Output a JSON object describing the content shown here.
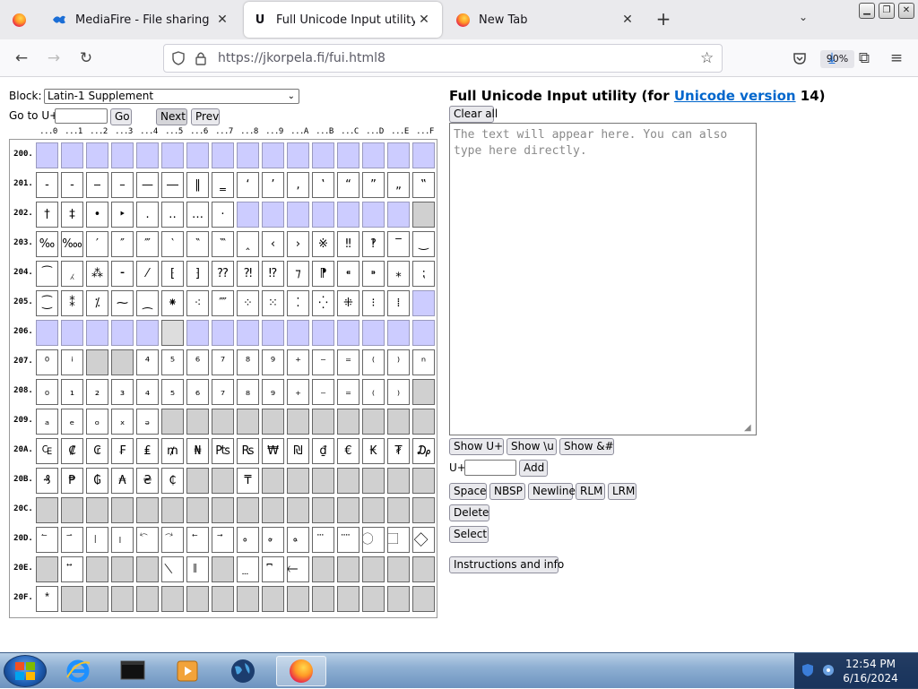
{
  "browser": {
    "tabs": [
      {
        "title": "MediaFire - File sharing and sto",
        "icon": "mediafire-icon",
        "active": false
      },
      {
        "title": "Full Unicode Input utility",
        "icon": "page-icon",
        "active": true
      },
      {
        "title": "New Tab",
        "icon": "firefox-icon",
        "active": false
      }
    ],
    "new_tab": "+",
    "url": "https://jkorpela.fi/fui.html8",
    "zoom": "90%"
  },
  "page": {
    "block_label": "Block:",
    "block_value": "Latin-1 Supplement",
    "goto_label": "Go to U+",
    "go_button": "Go",
    "next_button": "Next",
    "prev_button": "Prev",
    "hex_header": [
      "...0",
      "...1",
      "...2",
      "...3",
      "...4",
      "...5",
      "...6",
      "...7",
      "...8",
      "...9",
      "...A",
      "...B",
      "...C",
      "...D",
      "...E",
      "...F"
    ],
    "rows": [
      {
        "label": "200.",
        "cells": [
          "",
          "",
          "",
          "",
          "",
          "",
          "",
          "",
          "",
          "",
          "",
          "",
          "",
          "",
          "",
          ""
        ]
      },
      {
        "label": "201.",
        "cells": [
          "‐",
          "‑",
          "‒",
          "–",
          "—",
          "―",
          "‖",
          "‗",
          "‘",
          "’",
          "‚",
          "‛",
          "“",
          "”",
          "„",
          "‟"
        ]
      },
      {
        "label": "202.",
        "cells": [
          "†",
          "‡",
          "•",
          "‣",
          "․",
          "‥",
          "…",
          "‧",
          "",
          "",
          "",
          "",
          "",
          "",
          "",
          ""
        ]
      },
      {
        "label": "203.",
        "cells": [
          "‰",
          "‱",
          "′",
          "″",
          "‴",
          "‵",
          "‶",
          "‷",
          "‸",
          "‹",
          "›",
          "※",
          "‼",
          "‽",
          "‾",
          "‿"
        ]
      },
      {
        "label": "204.",
        "cells": [
          "⁀",
          "⁁",
          "⁂",
          "⁃",
          "⁄",
          "⁅",
          "⁆",
          "⁇",
          "⁈",
          "⁉",
          "⁊",
          "⁋",
          "⁌",
          "⁍",
          "⁎",
          "⁏"
        ]
      },
      {
        "label": "205.",
        "cells": [
          "⁐",
          "⁑",
          "⁒",
          "⁓",
          "⁔",
          "⁕",
          "⁖",
          "⁗",
          "⁘",
          "⁙",
          "⁚",
          "⁛",
          "⁜",
          "⁝",
          "⁞",
          ""
        ]
      },
      {
        "label": "206.",
        "cells": [
          "",
          "",
          "",
          "",
          "",
          "",
          "",
          "",
          "",
          "",
          "",
          "",
          "",
          "",
          "",
          ""
        ]
      },
      {
        "label": "207.",
        "cells": [
          "⁰",
          "ⁱ",
          "",
          "",
          "⁴",
          "⁵",
          "⁶",
          "⁷",
          "⁸",
          "⁹",
          "⁺",
          "⁻",
          "⁼",
          "⁽",
          "⁾",
          "ⁿ"
        ]
      },
      {
        "label": "208.",
        "cells": [
          "₀",
          "₁",
          "₂",
          "₃",
          "₄",
          "₅",
          "₆",
          "₇",
          "₈",
          "₉",
          "₊",
          "₋",
          "₌",
          "₍",
          "₎",
          ""
        ]
      },
      {
        "label": "209.",
        "cells": [
          "ₐ",
          "ₑ",
          "ₒ",
          "ₓ",
          "ₔ",
          "",
          "",
          "",
          "",
          "",
          "",
          "",
          "",
          "",
          "",
          ""
        ]
      },
      {
        "label": "20A.",
        "cells": [
          "₠",
          "₡",
          "₢",
          "₣",
          "₤",
          "₥",
          "₦",
          "₧",
          "₨",
          "₩",
          "₪",
          "₫",
          "€",
          "₭",
          "₮",
          "₯"
        ]
      },
      {
        "label": "20B.",
        "cells": [
          "₰",
          "₱",
          "₲",
          "₳",
          "₴",
          "₵",
          "",
          "",
          "₸",
          "",
          "",
          "",
          "",
          "",
          "",
          ""
        ]
      },
      {
        "label": "20C.",
        "cells": [
          "",
          "",
          "",
          "",
          "",
          "",
          "",
          "",
          "",
          "",
          "",
          "",
          "",
          "",
          "",
          ""
        ]
      },
      {
        "label": "20D.",
        "cells": [
          "⃐",
          "⃑",
          "⃒",
          "⃓",
          "⃔",
          "⃕",
          "⃖",
          "⃗",
          "⃘",
          "⃙",
          "⃚",
          "⃛",
          "⃜",
          "⃝",
          "⃞",
          "⃟"
        ]
      },
      {
        "label": "20E.",
        "cells": [
          "",
          "⃡",
          "",
          "",
          "",
          "⃥",
          "⃦",
          "",
          "⃨",
          "⃩",
          "⃪",
          "",
          "",
          "",
          "",
          ""
        ]
      },
      {
        "label": "20F.",
        "cells": [
          "⃰",
          "",
          "",
          "",
          "",
          "",
          "",
          "",
          "",
          "",
          "",
          "",
          "",
          "",
          "",
          ""
        ]
      }
    ],
    "title_text": "Full Unicode Input utility (for ",
    "title_link": "Unicode version",
    "title_version": " 14)",
    "clear_all": "Clear all",
    "textarea_placeholder": "The text will appear here. You can also type here directly.",
    "show_u": "Show U+",
    "show_slash_u": "Show \\u",
    "show_entity": "Show &#",
    "uplus_label": "U+",
    "add_button": "Add",
    "space_button": "Space",
    "nbsp_button": "NBSP",
    "newline_button": "Newline",
    "rlm_button": "RLM",
    "lrm_button": "LRM",
    "delete_button": "Delete",
    "select_button": "Select",
    "instructions_button": "Instructions and info"
  },
  "taskbar": {
    "time": "12:54 PM",
    "date": "6/16/2024"
  }
}
